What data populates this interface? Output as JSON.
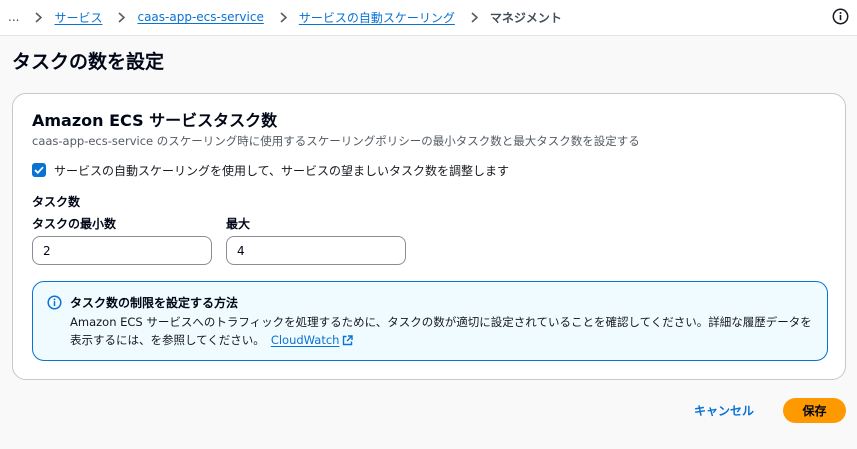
{
  "breadcrumb": {
    "ellipsis": "...",
    "items": [
      "サービス",
      "caas-app-ecs-service",
      "サービスの自動スケーリング"
    ],
    "current": "マネジメント"
  },
  "page": {
    "title": "タスクの数を設定"
  },
  "panel": {
    "title": "Amazon ECS サービスタスク数",
    "description": "caas-app-ecs-service のスケーリング時に使用するスケーリングポリシーの最小タスク数と最大タスク数を設定する",
    "checkbox": {
      "label": "サービスの自動スケーリングを使用して、サービスの望ましいタスク数を調整します",
      "checked": true
    },
    "task_count": {
      "group_label": "タスク数",
      "min_label": "タスクの最小数",
      "min_value": "2",
      "max_label": "最大",
      "max_value": "4"
    },
    "alert": {
      "title": "タスク数の制限を設定する方法",
      "body": "Amazon ECS サービスへのトラフィックを処理するために、タスクの数が適切に設定されていることを確認してください。詳細な履歴データを表示するには、を参照してください。",
      "link": "CloudWatch"
    }
  },
  "footer": {
    "cancel": "キャンセル",
    "save": "保存"
  },
  "colors": {
    "link": "#0972d3",
    "primary_button": "#ff9900",
    "info_bg": "#f0fbff",
    "info_border": "#0972d3"
  },
  "icons": {
    "info": "info-icon",
    "chevron": "chevron-right-icon",
    "check": "check-icon",
    "external": "external-link-icon"
  }
}
